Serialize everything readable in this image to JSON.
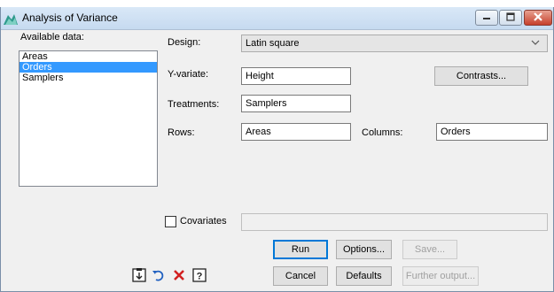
{
  "window": {
    "title": "Analysis of Variance"
  },
  "available": {
    "label": "Available data:",
    "items": [
      "Areas",
      "Orders",
      "Samplers"
    ],
    "selected_index": 1
  },
  "design": {
    "label": "Design:",
    "value": "Latin square"
  },
  "yvariate": {
    "label": "Y-variate:",
    "value": "Height"
  },
  "treatments": {
    "label": "Treatments:",
    "value": "Samplers"
  },
  "rows": {
    "label": "Rows:",
    "value": "Areas"
  },
  "columns": {
    "label": "Columns:",
    "value": "Orders"
  },
  "covariates": {
    "label": "Covariates",
    "checked": false,
    "value": ""
  },
  "buttons": {
    "contrasts": "Contrasts...",
    "run": "Run",
    "options": "Options...",
    "save": "Save...",
    "cancel": "Cancel",
    "defaults": "Defaults",
    "further_output": "Further output..."
  },
  "icons": {
    "app": "anova-chart-icon",
    "copy": "copy-to-clipboard-icon",
    "undo": "undo-icon",
    "clear": "clear-icon",
    "help": "help-icon"
  },
  "colors": {
    "selection": "#3399ff",
    "close_button": "#c6402c",
    "default_button_border": "#0078d7"
  }
}
